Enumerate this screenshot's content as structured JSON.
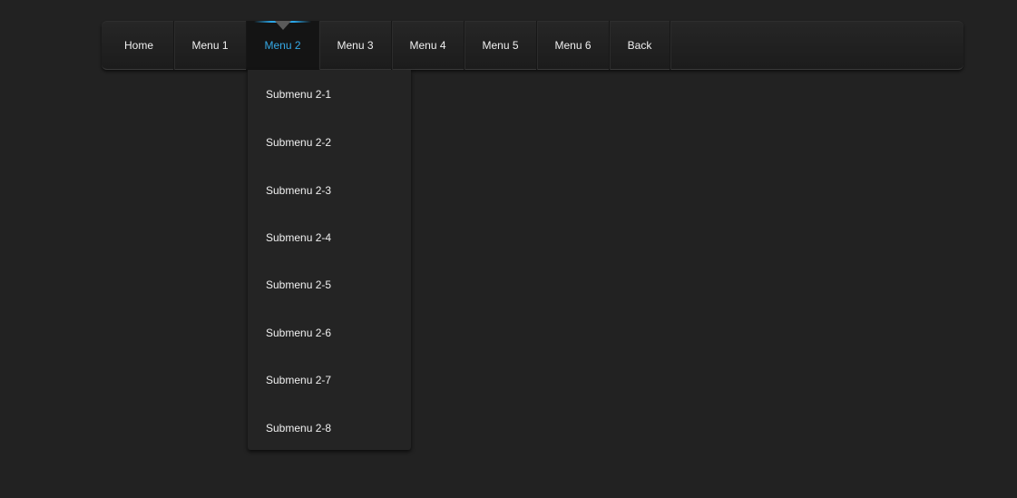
{
  "nav": {
    "items": [
      {
        "label": "Home"
      },
      {
        "label": "Menu 1"
      },
      {
        "label": "Menu 2"
      },
      {
        "label": "Menu 3"
      },
      {
        "label": "Menu 4"
      },
      {
        "label": "Menu 5"
      },
      {
        "label": "Menu 6"
      },
      {
        "label": "Back"
      }
    ],
    "active_index": 2
  },
  "submenu": {
    "items": [
      {
        "label": "Submenu 2-1"
      },
      {
        "label": "Submenu 2-2"
      },
      {
        "label": "Submenu 2-3"
      },
      {
        "label": "Submenu 2-4"
      },
      {
        "label": "Submenu 2-5"
      },
      {
        "label": "Submenu 2-6"
      },
      {
        "label": "Submenu 2-7"
      },
      {
        "label": "Submenu 2-8"
      }
    ]
  },
  "colors": {
    "background": "#222222",
    "accent": "#35a9e6",
    "text": "#f0f0f0"
  }
}
